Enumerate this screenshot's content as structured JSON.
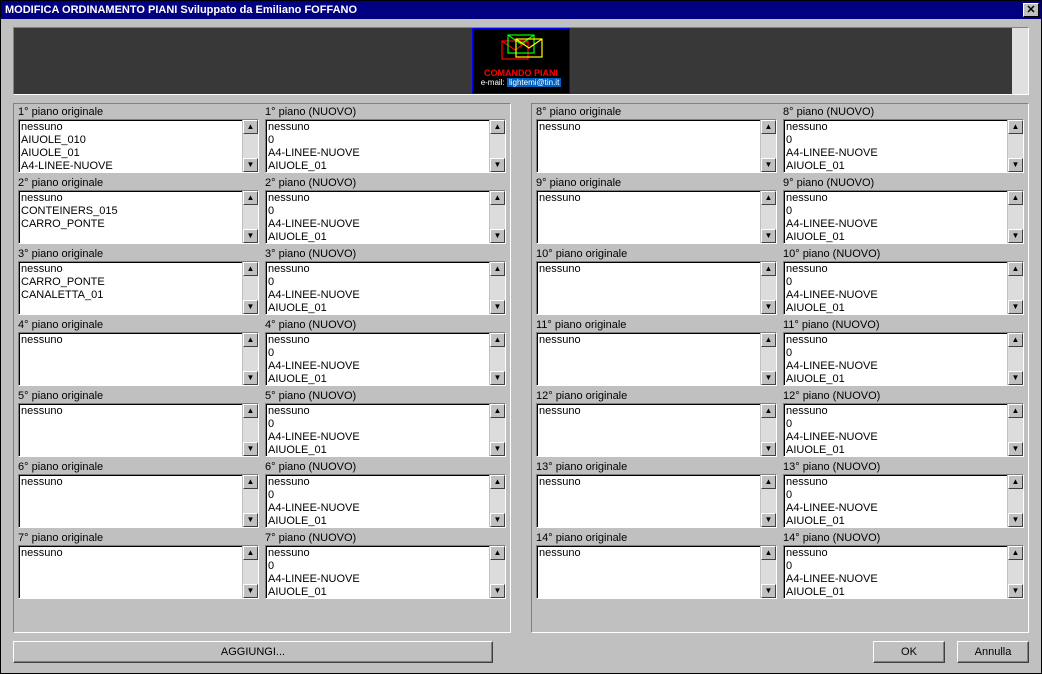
{
  "title": "MODIFICA ORDINAMENTO PIANI Sviluppato da Emiliano FOFFANO",
  "logo": {
    "line1": "COMANDO PIANI",
    "line2_prefix": "e-mail:",
    "line2_hl": "lightemi@tin.it"
  },
  "nuovo_default": [
    "nessuno",
    "0",
    "A4-LINEE-NUOVE",
    "AIUOLE_01"
  ],
  "left": [
    {
      "orig_label": "1° piano originale",
      "nuovo_label": "1° piano (NUOVO)",
      "orig_items": [
        "nessuno",
        "AIUOLE_010",
        "AIUOLE_01",
        "A4-LINEE-NUOVE"
      ]
    },
    {
      "orig_label": "2° piano originale",
      "nuovo_label": "2° piano (NUOVO)",
      "orig_items": [
        "nessuno",
        "CONTEINERS_015",
        "CARRO_PONTE"
      ]
    },
    {
      "orig_label": "3° piano originale",
      "nuovo_label": "3° piano (NUOVO)",
      "orig_items": [
        "nessuno",
        "CARRO_PONTE",
        "CANALETTA_01"
      ]
    },
    {
      "orig_label": "4° piano originale",
      "nuovo_label": "4° piano (NUOVO)",
      "orig_items": [
        "nessuno"
      ]
    },
    {
      "orig_label": "5° piano originale",
      "nuovo_label": "5° piano (NUOVO)",
      "orig_items": [
        "nessuno"
      ]
    },
    {
      "orig_label": "6° piano originale",
      "nuovo_label": "6° piano (NUOVO)",
      "orig_items": [
        "nessuno"
      ]
    },
    {
      "orig_label": "7° piano originale",
      "nuovo_label": "7° piano (NUOVO)",
      "orig_items": [
        "nessuno"
      ]
    }
  ],
  "right": [
    {
      "orig_label": "8° piano originale",
      "nuovo_label": "8° piano (NUOVO)",
      "orig_items": [
        "nessuno"
      ]
    },
    {
      "orig_label": "9° piano originale",
      "nuovo_label": "9° piano (NUOVO)",
      "orig_items": [
        "nessuno"
      ]
    },
    {
      "orig_label": "10° piano originale",
      "nuovo_label": "10° piano (NUOVO)",
      "orig_items": [
        "nessuno"
      ]
    },
    {
      "orig_label": "11° piano originale",
      "nuovo_label": "11° piano (NUOVO)",
      "orig_items": [
        "nessuno"
      ]
    },
    {
      "orig_label": "12° piano originale",
      "nuovo_label": "12° piano (NUOVO)",
      "orig_items": [
        "nessuno"
      ]
    },
    {
      "orig_label": "13° piano originale",
      "nuovo_label": "13° piano (NUOVO)",
      "orig_items": [
        "nessuno"
      ]
    },
    {
      "orig_label": "14° piano originale",
      "nuovo_label": "14° piano (NUOVO)",
      "orig_items": [
        "nessuno"
      ]
    }
  ],
  "buttons": {
    "aggiungi": "AGGIUNGI...",
    "ok": "OK",
    "annulla": "Annulla"
  }
}
